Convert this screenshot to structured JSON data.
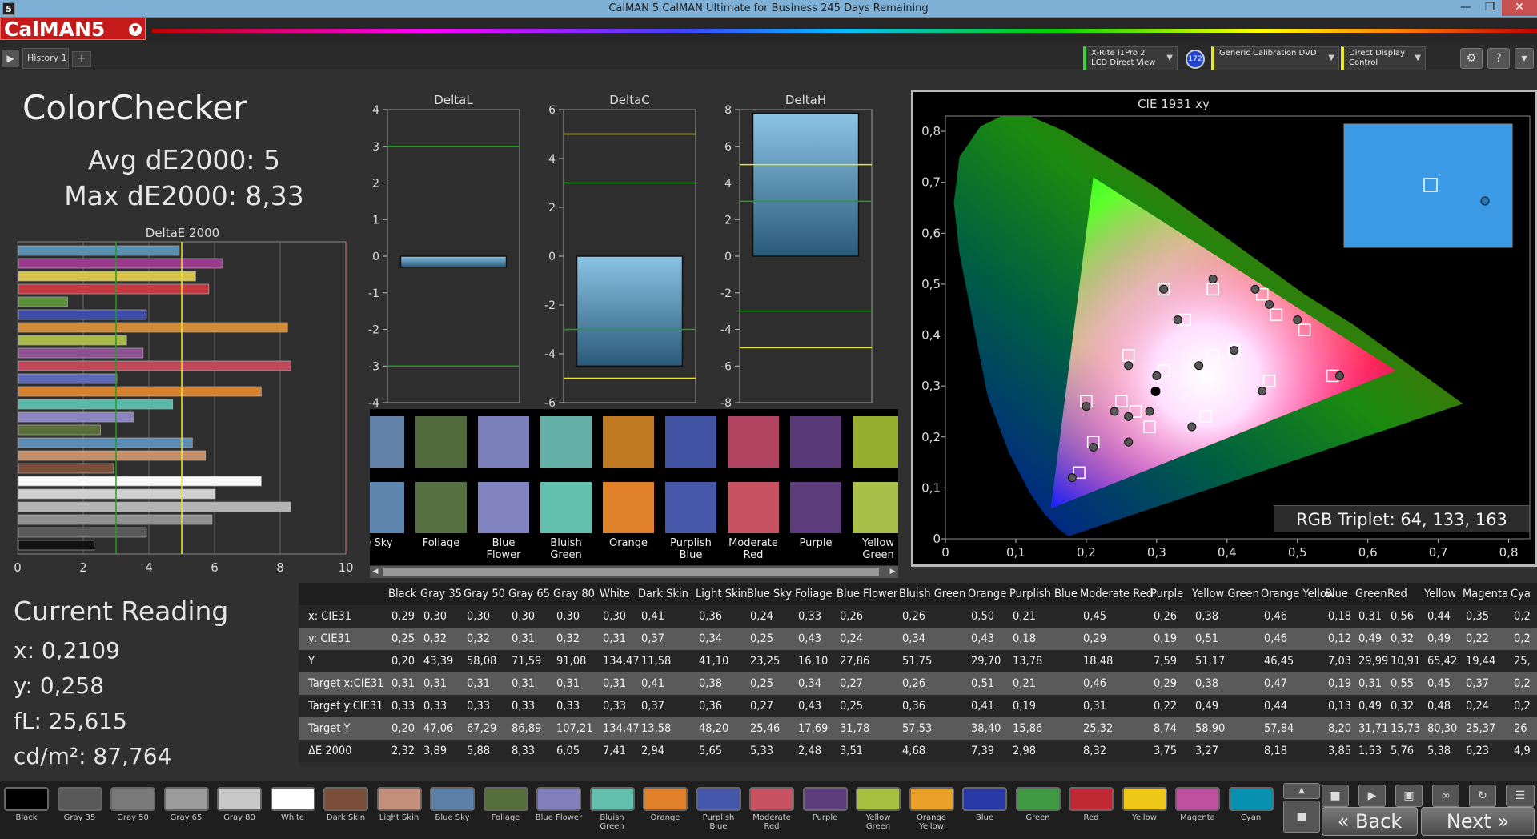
{
  "window": {
    "title": "CalMAN 5 CalMAN Ultimate for Business 245 Days Remaining",
    "app_icon": "5",
    "min": "—",
    "max": "❐",
    "close": "✕"
  },
  "logo": {
    "text": "CalMAN5"
  },
  "tabs": {
    "history": "History 1",
    "add": "+"
  },
  "devices": {
    "meter": "X-Rite i1Pro 2",
    "meter_mode": "LCD Direct View",
    "badge": "172",
    "source": "Generic Calibration DVD",
    "display": "Direct Display Control"
  },
  "summary": {
    "title": "ColorChecker",
    "avg": "Avg dE2000: 5",
    "max": "Max dE2000: 8,33"
  },
  "current": {
    "title": "Current Reading",
    "x": "x: 0,2109",
    "y": "y: 0,258",
    "fl": "fL: 25,615",
    "cdm": "cd/m²: 87,764"
  },
  "deltae_chart": {
    "type": "bar",
    "title": "DeltaE 2000",
    "xlim": [
      0,
      10
    ],
    "xticks": [
      "0",
      "2",
      "4",
      "6",
      "8",
      "10"
    ],
    "thresholds": [
      3,
      5
    ],
    "values": [
      4.9,
      6.2,
      5.4,
      5.8,
      1.5,
      3.9,
      8.2,
      3.3,
      3.8,
      8.3,
      3.0,
      7.4,
      4.7,
      3.5,
      2.5,
      5.3,
      5.7,
      2.9,
      7.4,
      6.0,
      8.3,
      5.9,
      3.9,
      2.3
    ],
    "colors": [
      "#5b8fb0",
      "#9a3a8c",
      "#d6c24a",
      "#c43a40",
      "#5a8f3a",
      "#3e4ea8",
      "#d08c38",
      "#a8b84a",
      "#8c4f92",
      "#c0485a",
      "#5e6ab8",
      "#d48230",
      "#5ab8a8",
      "#8c84c0",
      "#5a6e3a",
      "#5c8cb4",
      "#c4906c",
      "#7a4e38",
      "#f8f8f8",
      "#d0d0d0",
      "#b4b4b4",
      "#909090",
      "#5a5a5a",
      "#111111"
    ]
  },
  "deltal_chart": {
    "type": "bar",
    "title": "DeltaL",
    "ylim": [
      -4,
      4
    ],
    "yticks": [
      "4",
      "3",
      "2",
      "1",
      "0",
      "-1",
      "-2",
      "-3",
      "-4"
    ],
    "value": -0.3,
    "green_lines": [
      3,
      -3
    ]
  },
  "deltac_chart": {
    "type": "bar",
    "title": "DeltaC",
    "ylim": [
      -6,
      6
    ],
    "yticks": [
      "6",
      "4",
      "2",
      "0",
      "-2",
      "-4",
      "-6"
    ],
    "value": -4.5,
    "green_lines": [
      3,
      -3
    ],
    "yellow_lines": [
      5,
      -5
    ]
  },
  "deltah_chart": {
    "type": "bar",
    "title": "DeltaH",
    "ylim": [
      -8,
      8
    ],
    "yticks": [
      "8",
      "6",
      "4",
      "2",
      "0",
      "-2",
      "-4",
      "-6",
      "-8"
    ],
    "value": 7.8,
    "green_lines": [
      3,
      -3
    ],
    "yellow_lines": [
      5,
      -5
    ]
  },
  "patches": [
    {
      "name": "Blue Sky",
      "label": "e Sky",
      "top": "#6082a6",
      "bot": "#5f86ac"
    },
    {
      "name": "Foliage",
      "label": "Foliage",
      "top": "#516b3d",
      "bot": "#567041"
    },
    {
      "name": "Blue Flower",
      "label": "Blue\nFlower",
      "top": "#7c80ba",
      "bot": "#8284bf"
    },
    {
      "name": "Bluish Green",
      "label": "Bluish\nGreen",
      "top": "#64b0a6",
      "bot": "#62c0ae"
    },
    {
      "name": "Orange",
      "label": "Orange",
      "top": "#c07a22",
      "bot": "#e08028"
    },
    {
      "name": "Purplish Blue",
      "label": "Purplish\nBlue",
      "top": "#4454a4",
      "bot": "#4858aa"
    },
    {
      "name": "Moderate Red",
      "label": "Moderate\nRed",
      "top": "#b0445e",
      "bot": "#c85262"
    },
    {
      "name": "Purple",
      "label": "Purple",
      "top": "#5a3a78",
      "bot": "#5c3c7a"
    },
    {
      "name": "Yellow Green",
      "label": "Yellow\nGreen",
      "top": "#98ae30",
      "bot": "#a8c04a"
    }
  ],
  "table": {
    "headers": [
      "Black",
      "Gray 35",
      "Gray 50",
      "Gray 65",
      "Gray 80",
      "White",
      "Dark Skin",
      "Light Skin",
      "Blue Sky",
      "Foliage",
      "Blue Flower",
      "Bluish Green",
      "Orange",
      "Purplish Blue",
      "Moderate Red",
      "Purple",
      "Yellow Green",
      "Orange Yellow",
      "Blue",
      "Green",
      "Red",
      "Yellow",
      "Magenta",
      "Cya"
    ],
    "rows": [
      {
        "label": "x: CIE31",
        "values": [
          "0,29",
          "0,30",
          "0,30",
          "0,30",
          "0,30",
          "0,30",
          "0,41",
          "0,36",
          "0,24",
          "0,33",
          "0,26",
          "0,26",
          "0,50",
          "0,21",
          "0,45",
          "0,26",
          "0,38",
          "0,46",
          "0,18",
          "0,31",
          "0,56",
          "0,44",
          "0,35",
          "0,2"
        ]
      },
      {
        "label": "y: CIE31",
        "values": [
          "0,25",
          "0,32",
          "0,32",
          "0,31",
          "0,32",
          "0,31",
          "0,37",
          "0,34",
          "0,25",
          "0,43",
          "0,24",
          "0,34",
          "0,43",
          "0,18",
          "0,29",
          "0,19",
          "0,51",
          "0,46",
          "0,12",
          "0,49",
          "0,32",
          "0,49",
          "0,22",
          "0,2"
        ]
      },
      {
        "label": "Y",
        "values": [
          "0,20",
          "43,39",
          "58,08",
          "71,59",
          "91,08",
          "134,47",
          "11,58",
          "41,10",
          "23,25",
          "16,10",
          "27,86",
          "51,75",
          "29,70",
          "13,78",
          "18,48",
          "7,59",
          "51,17",
          "46,45",
          "7,03",
          "29,99",
          "10,91",
          "65,42",
          "19,44",
          "25,"
        ]
      },
      {
        "label": "Target x:CIE31",
        "values": [
          "0,31",
          "0,31",
          "0,31",
          "0,31",
          "0,31",
          "0,31",
          "0,41",
          "0,38",
          "0,25",
          "0,34",
          "0,27",
          "0,26",
          "0,51",
          "0,21",
          "0,46",
          "0,29",
          "0,38",
          "0,47",
          "0,19",
          "0,31",
          "0,55",
          "0,45",
          "0,37",
          "0,2"
        ]
      },
      {
        "label": "Target y:CIE31",
        "values": [
          "0,33",
          "0,33",
          "0,33",
          "0,33",
          "0,33",
          "0,33",
          "0,37",
          "0,36",
          "0,27",
          "0,43",
          "0,25",
          "0,36",
          "0,41",
          "0,19",
          "0,31",
          "0,22",
          "0,49",
          "0,44",
          "0,13",
          "0,49",
          "0,32",
          "0,48",
          "0,24",
          "0,2"
        ]
      },
      {
        "label": "Target Y",
        "values": [
          "0,20",
          "47,06",
          "67,29",
          "86,89",
          "107,21",
          "134,47",
          "13,58",
          "48,20",
          "25,46",
          "17,69",
          "31,78",
          "57,53",
          "38,40",
          "15,86",
          "25,32",
          "8,74",
          "58,90",
          "57,84",
          "8,20",
          "31,71",
          "15,73",
          "80,30",
          "25,37",
          "26"
        ]
      },
      {
        "label": "ΔE 2000",
        "values": [
          "2,32",
          "3,89",
          "5,88",
          "8,33",
          "6,05",
          "7,41",
          "2,94",
          "5,65",
          "5,33",
          "2,48",
          "3,51",
          "4,68",
          "7,39",
          "2,98",
          "8,32",
          "3,75",
          "3,27",
          "8,18",
          "3,85",
          "1,53",
          "5,76",
          "5,38",
          "6,23",
          "4,9"
        ]
      }
    ]
  },
  "cie": {
    "title": "CIE 1931 xy",
    "xticks": [
      "0",
      "0,1",
      "0,2",
      "0,3",
      "0,4",
      "0,5",
      "0,6",
      "0,7",
      "0,8"
    ],
    "yticks": [
      "0,8",
      "0,7",
      "0,6",
      "0,5",
      "0,4",
      "0,3",
      "0,2",
      "0,1",
      "0"
    ],
    "rgb_triplet": "RGB Triplet: 64, 133, 163",
    "points": [
      {
        "x": 0.29,
        "y": 0.25,
        "tx": 0.31,
        "ty": 0.33
      },
      {
        "x": 0.3,
        "y": 0.32,
        "tx": 0.31,
        "ty": 0.33
      },
      {
        "x": 0.41,
        "y": 0.37,
        "tx": 0.41,
        "ty": 0.37
      },
      {
        "x": 0.36,
        "y": 0.34,
        "tx": 0.38,
        "ty": 0.36
      },
      {
        "x": 0.24,
        "y": 0.25,
        "tx": 0.25,
        "ty": 0.27
      },
      {
        "x": 0.33,
        "y": 0.43,
        "tx": 0.34,
        "ty": 0.43
      },
      {
        "x": 0.26,
        "y": 0.24,
        "tx": 0.27,
        "ty": 0.25
      },
      {
        "x": 0.26,
        "y": 0.34,
        "tx": 0.26,
        "ty": 0.36
      },
      {
        "x": 0.5,
        "y": 0.43,
        "tx": 0.51,
        "ty": 0.41
      },
      {
        "x": 0.21,
        "y": 0.18,
        "tx": 0.21,
        "ty": 0.19
      },
      {
        "x": 0.45,
        "y": 0.29,
        "tx": 0.46,
        "ty": 0.31
      },
      {
        "x": 0.26,
        "y": 0.19,
        "tx": 0.29,
        "ty": 0.22
      },
      {
        "x": 0.38,
        "y": 0.51,
        "tx": 0.38,
        "ty": 0.49
      },
      {
        "x": 0.46,
        "y": 0.46,
        "tx": 0.47,
        "ty": 0.44
      },
      {
        "x": 0.18,
        "y": 0.12,
        "tx": 0.19,
        "ty": 0.13
      },
      {
        "x": 0.31,
        "y": 0.49,
        "tx": 0.31,
        "ty": 0.49
      },
      {
        "x": 0.56,
        "y": 0.32,
        "tx": 0.55,
        "ty": 0.32
      },
      {
        "x": 0.44,
        "y": 0.49,
        "tx": 0.45,
        "ty": 0.48
      },
      {
        "x": 0.35,
        "y": 0.22,
        "tx": 0.37,
        "ty": 0.24
      },
      {
        "x": 0.2,
        "y": 0.26,
        "tx": 0.2,
        "ty": 0.27
      }
    ],
    "current": {
      "x": 0.2109,
      "y": 0.258
    },
    "inset_color": "#3a9ae6"
  },
  "bottom_swatches": [
    {
      "label": "Black",
      "color": "#000000"
    },
    {
      "label": "Gray 35",
      "color": "#595959"
    },
    {
      "label": "Gray 50",
      "color": "#7a7a7a"
    },
    {
      "label": "Gray 65",
      "color": "#9c9c9c"
    },
    {
      "label": "Gray 80",
      "color": "#c8c8c8"
    },
    {
      "label": "White",
      "color": "#ffffff"
    },
    {
      "label": "Dark Skin",
      "color": "#7a4e38"
    },
    {
      "label": "Light Skin",
      "color": "#c4907c"
    },
    {
      "label": "Blue Sky",
      "color": "#5c80a8"
    },
    {
      "label": "Foliage",
      "color": "#566e3c"
    },
    {
      "label": "Blue Flower",
      "color": "#8280bc"
    },
    {
      "label": "Bluish Green",
      "color": "#64c0ae"
    },
    {
      "label": "Orange",
      "color": "#e08028"
    },
    {
      "label": "Purplish Blue",
      "color": "#4656aa"
    },
    {
      "label": "Moderate Red",
      "color": "#c85262"
    },
    {
      "label": "Purple",
      "color": "#5c3c7a"
    },
    {
      "label": "Yellow Green",
      "color": "#a8c040"
    },
    {
      "label": "Orange Yellow",
      "color": "#eaa028"
    },
    {
      "label": "Blue",
      "color": "#2838a4"
    },
    {
      "label": "Green",
      "color": "#409a44"
    },
    {
      "label": "Red",
      "color": "#c02834"
    },
    {
      "label": "Yellow",
      "color": "#f0c818"
    },
    {
      "label": "Magenta",
      "color": "#c050a0"
    },
    {
      "label": "Cyan",
      "color": "#0890b0"
    }
  ],
  "nav": {
    "back": "Back",
    "next": "Next"
  }
}
